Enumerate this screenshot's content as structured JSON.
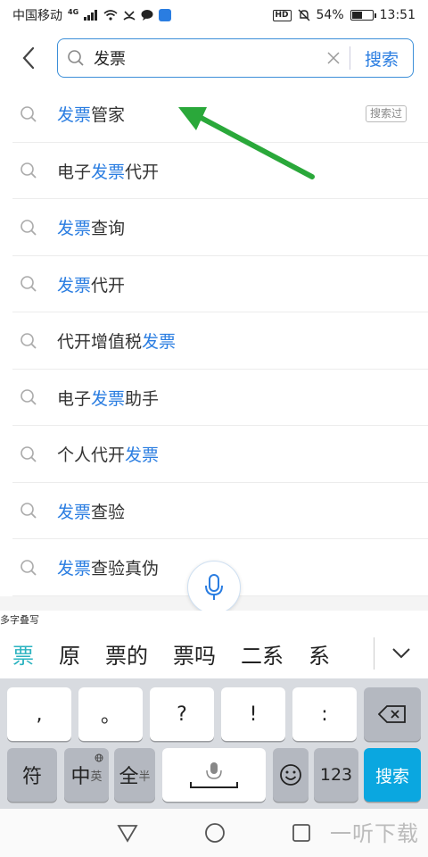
{
  "status_bar": {
    "carrier": "中国移动",
    "network": "4G",
    "battery_percent": "54%",
    "battery_level": 0.54,
    "hd_badge": "HD",
    "time": "13:51"
  },
  "search": {
    "query": "发票",
    "button_label": "搜索"
  },
  "suggestions": [
    {
      "parts": [
        {
          "t": "发票",
          "hl": true
        },
        {
          "t": "管家",
          "hl": false
        }
      ],
      "tag": "搜索过"
    },
    {
      "parts": [
        {
          "t": "电子",
          "hl": false
        },
        {
          "t": "发票",
          "hl": true
        },
        {
          "t": "代开",
          "hl": false
        }
      ]
    },
    {
      "parts": [
        {
          "t": "发票",
          "hl": true
        },
        {
          "t": "查询",
          "hl": false
        }
      ]
    },
    {
      "parts": [
        {
          "t": "发票",
          "hl": true
        },
        {
          "t": "代开",
          "hl": false
        }
      ]
    },
    {
      "parts": [
        {
          "t": "代开增值税",
          "hl": false
        },
        {
          "t": "发票",
          "hl": true
        }
      ]
    },
    {
      "parts": [
        {
          "t": "电子",
          "hl": false
        },
        {
          "t": "发票",
          "hl": true
        },
        {
          "t": "助手",
          "hl": false
        }
      ]
    },
    {
      "parts": [
        {
          "t": "个人代开",
          "hl": false
        },
        {
          "t": "发票",
          "hl": true
        }
      ]
    },
    {
      "parts": [
        {
          "t": "发票",
          "hl": true
        },
        {
          "t": "查验",
          "hl": false
        }
      ]
    },
    {
      "parts": [
        {
          "t": "发票",
          "hl": true
        },
        {
          "t": "查验真伪",
          "hl": false
        }
      ]
    }
  ],
  "ime": {
    "mode_hint": "多字叠写",
    "candidates": [
      "票",
      "原",
      "票的",
      "票吗",
      "二系",
      "系"
    ],
    "keys_row1": [
      ",",
      "。",
      "?",
      "!",
      ":"
    ],
    "key_symbol": "符",
    "key_lang_main": "中",
    "key_lang_alt": "英",
    "key_width_main": "全",
    "key_width_alt": "半",
    "key_numbers": "123",
    "key_go": "搜索"
  },
  "watermark": "一听下载",
  "colors": {
    "accent": "#2a7de1",
    "highlight": "#2a7de1",
    "arrow": "#2aa83a",
    "candidate_active": "#2bb3c0",
    "go_key": "#0aa7e0"
  },
  "icons": {
    "back": "chevron-left-icon",
    "search": "magnifier-icon",
    "clear": "close-icon",
    "voice": "microphone-icon",
    "backspace": "backspace-icon",
    "emoji": "smiley-icon",
    "expand": "chevron-down-icon"
  }
}
